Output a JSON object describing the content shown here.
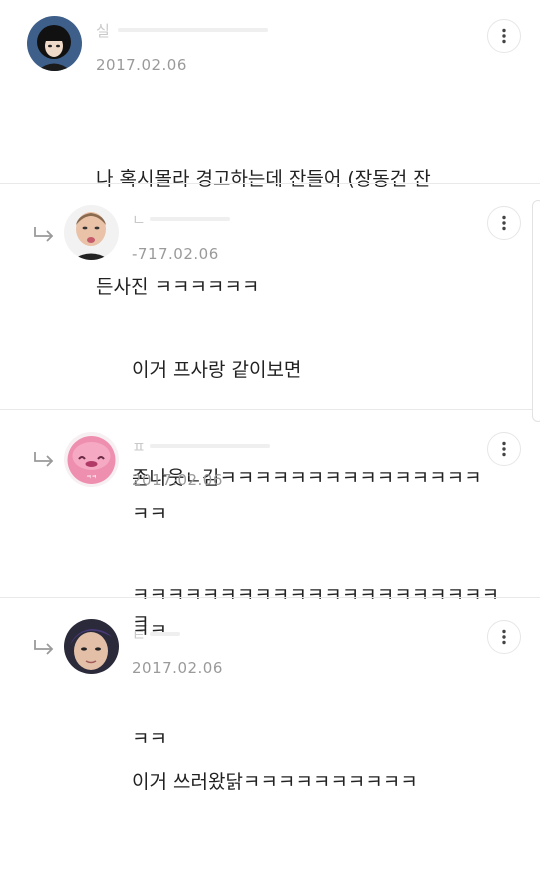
{
  "comments": [
    {
      "username": "실",
      "date": "2017.02.06",
      "lines": [
        "나 혹시몰라 경고하는데 잔들어 (장동건 잔",
        "든사진 ㅋㅋㅋㅋㅋㅋ"
      ],
      "is_reply": false,
      "avatar": "avatar-anime-girl"
    },
    {
      "username": "ㄴ",
      "date": "-717.02.06",
      "lines": [
        "이거 프사랑 같이보면",
        "존나웃ㄴ김ㅋㅋㅋㅋㅋㅋㅋㅋㅋㅋㅋㅋㅋㅋㅋㅋㅋ",
        "ㅋ"
      ],
      "is_reply": true,
      "avatar": "avatar-3d-face"
    },
    {
      "username": "ㅍ",
      "date": "2017.02.06",
      "lines": [
        "ㅋㅋㅋㅋㅋㅋㅋㅋㅋㅋㅋㅋㅋㅋㅋㅋㅋㅋㅋㅋㅋㅋㅋ",
        "ㅋㅋ"
      ],
      "is_reply": true,
      "avatar": "avatar-pink-blob"
    },
    {
      "username": "ㅌ",
      "date": "2017.02.06",
      "lines": [
        "이거 쓰러왔닭ㅋㅋㅋㅋㅋㅋㅋㅋㅋㅋ"
      ],
      "is_reply": true,
      "avatar": "avatar-face-photo"
    }
  ],
  "icons": {
    "more": "more-vertical-icon",
    "reply": "reply-arrow-icon"
  },
  "colors": {
    "date": "#9a9a9a",
    "divider": "#e9e9e9",
    "text": "#222222"
  }
}
